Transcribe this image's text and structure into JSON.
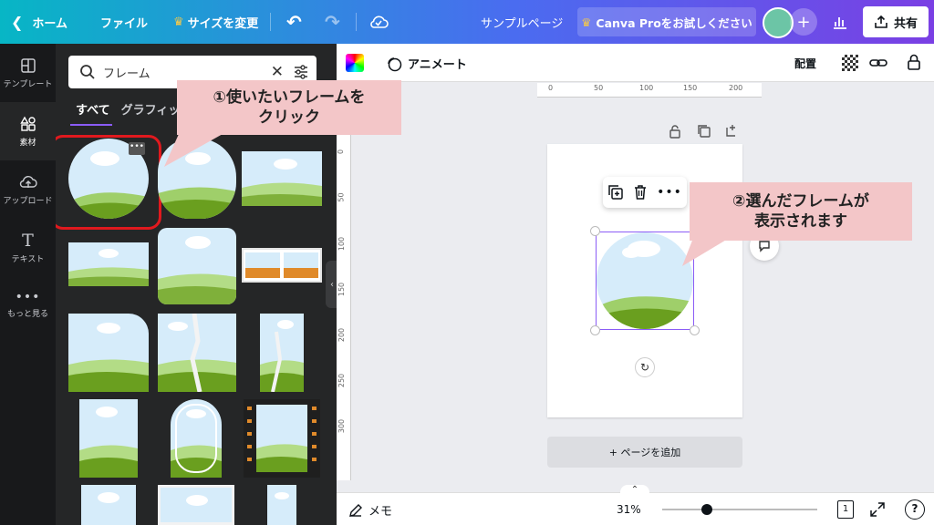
{
  "topbar": {
    "home_label": "ホーム",
    "file_label": "ファイル",
    "resize_label": "サイズを変更",
    "page_title": "サンプルページ",
    "pro_label": "Canva Proをお試しください",
    "share_label": "共有"
  },
  "rail": {
    "items": [
      {
        "label": "テンプレート",
        "icon": "layout-icon"
      },
      {
        "label": "素材",
        "icon": "shapes-icon"
      },
      {
        "label": "アップロード",
        "icon": "cloud-upload-icon"
      },
      {
        "label": "テキスト",
        "icon": "text-icon"
      },
      {
        "label": "もっと見る",
        "icon": "more-icon"
      }
    ]
  },
  "panel": {
    "search_value": "フレーム",
    "tabs": [
      "すべて",
      "グラフィック"
    ]
  },
  "toolbar2": {
    "animate_label": "アニメート",
    "arrange_label": "配置"
  },
  "ruler": {
    "h_ticks": [
      "0",
      "50",
      "100",
      "150",
      "200"
    ],
    "v_ticks": [
      "0",
      "50",
      "100",
      "150",
      "200",
      "250",
      "300"
    ]
  },
  "canvas": {
    "add_page_label": "+ ページを追加"
  },
  "bottombar": {
    "notes_label": "メモ",
    "zoom_label": "31%",
    "page_count": "1",
    "help_label": "?"
  },
  "callouts": {
    "step1_line1": "①使いたいフレームを",
    "step1_line2": "クリック",
    "step2_line1": "②選んだフレームが",
    "step2_line2": "表示されます"
  },
  "colors": {
    "accent": "#8b5cf6",
    "highlight": "#e0191e",
    "callout": "#f3c6c8"
  }
}
